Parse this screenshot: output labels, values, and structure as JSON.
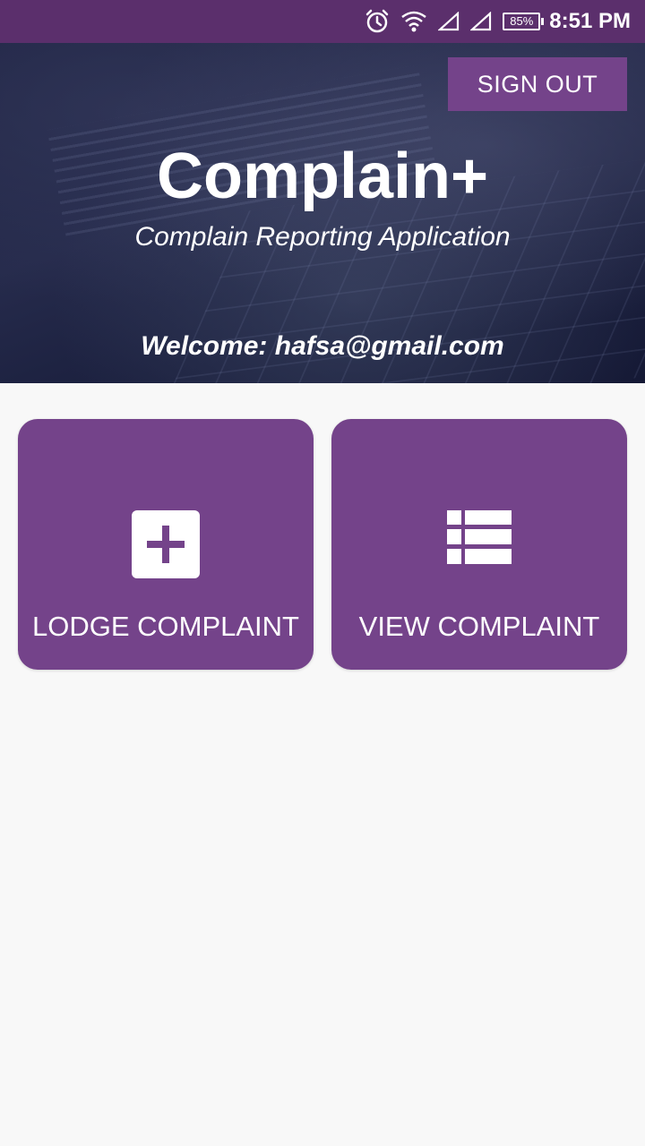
{
  "status_bar": {
    "battery": "85%",
    "time": "8:51 PM",
    "icons": [
      "alarm-icon",
      "wifi-icon",
      "signal-icon",
      "signal-icon",
      "battery-icon"
    ]
  },
  "header": {
    "sign_out_label": "SIGN OUT",
    "title": "Complain+",
    "subtitle": "Complain Reporting Application",
    "welcome": "Welcome: hafsa@gmail.com"
  },
  "cards": [
    {
      "label": "LODGE COMPLAINT",
      "icon": "plus-box-icon"
    },
    {
      "label": "VIEW COMPLAINT",
      "icon": "list-icon"
    }
  ],
  "colors": {
    "primary": "#74438a",
    "status_bar": "#5b2f6c",
    "background": "#f8f8f8"
  }
}
